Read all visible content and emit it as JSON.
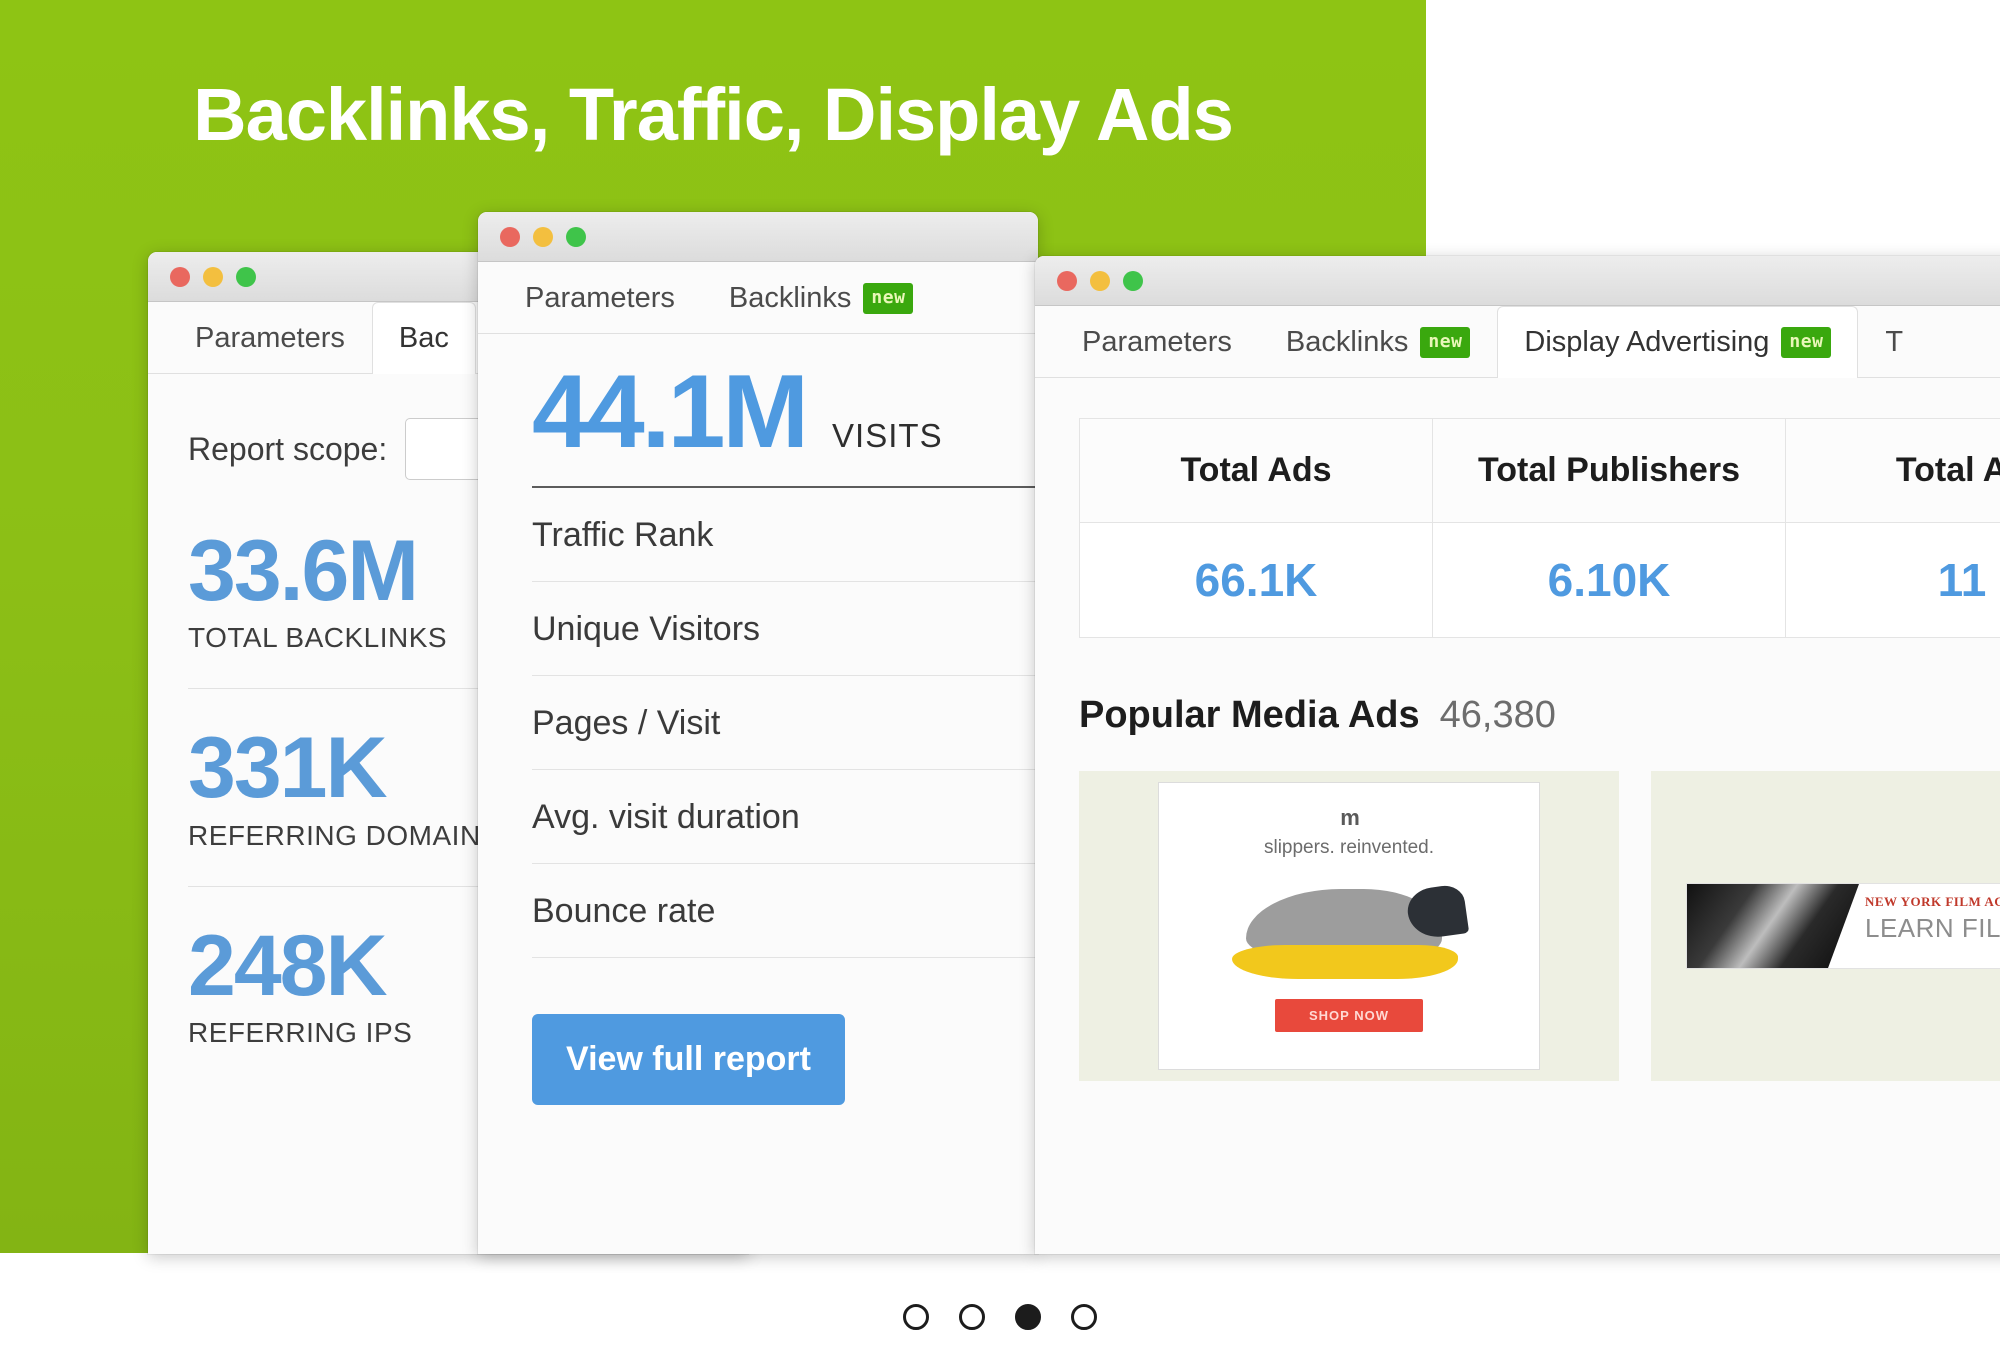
{
  "hero": {
    "title": "Backlinks, Traffic, Display Ads",
    "background_color": "#8cbf16"
  },
  "accent_colors": {
    "blue": "#4f9ae0",
    "green": "#8cbf16",
    "badge_green": "#3aa80e"
  },
  "window_backlinks": {
    "tabs": [
      {
        "label": "Parameters",
        "badge": "",
        "active": false
      },
      {
        "label": "Bac",
        "badge": "",
        "active": true
      }
    ],
    "report_scope_label": "Report scope:",
    "metrics": [
      {
        "value": "33.6M",
        "label": "TOTAL BACKLINKS"
      },
      {
        "value": "331K",
        "label": "REFERRING DOMAINS"
      },
      {
        "value": "248K",
        "label": "REFERRING IPS"
      }
    ]
  },
  "window_traffic": {
    "tabs": [
      {
        "label": "Parameters",
        "badge": "",
        "active": false
      },
      {
        "label": "Backlinks",
        "badge": "new",
        "active": false
      }
    ],
    "visits_value": "44.1M",
    "visits_caption": "VISITS",
    "metrics": [
      "Traffic Rank",
      "Unique Visitors",
      "Pages / Visit",
      "Avg. visit duration",
      "Bounce rate"
    ],
    "view_report_label": "View full report"
  },
  "window_ads": {
    "tabs": [
      {
        "label": "Parameters",
        "badge": "",
        "active": false
      },
      {
        "label": "Backlinks",
        "badge": "new",
        "active": false
      },
      {
        "label": "Display Advertising",
        "badge": "new",
        "active": true
      },
      {
        "label": "T",
        "badge": "",
        "active": false
      }
    ],
    "summary_table": {
      "headers": [
        "Total Ads",
        "Total Publishers",
        "Total Ad"
      ],
      "values": [
        "66.1K",
        "6.10K",
        "11"
      ]
    },
    "media_ads": {
      "title": "Popular Media Ads",
      "count": "46,380"
    },
    "creatives": [
      {
        "type": "slipper-ad",
        "logo": "m",
        "tagline": "slippers. reinvented.",
        "cta": "SHOP NOW"
      },
      {
        "type": "film-academy-ad",
        "brand": "NEW YORK FILM ACADEMY",
        "headline": "LEARN FILMMAKING"
      }
    ]
  },
  "carousel": {
    "total": 4,
    "active_index": 2
  }
}
